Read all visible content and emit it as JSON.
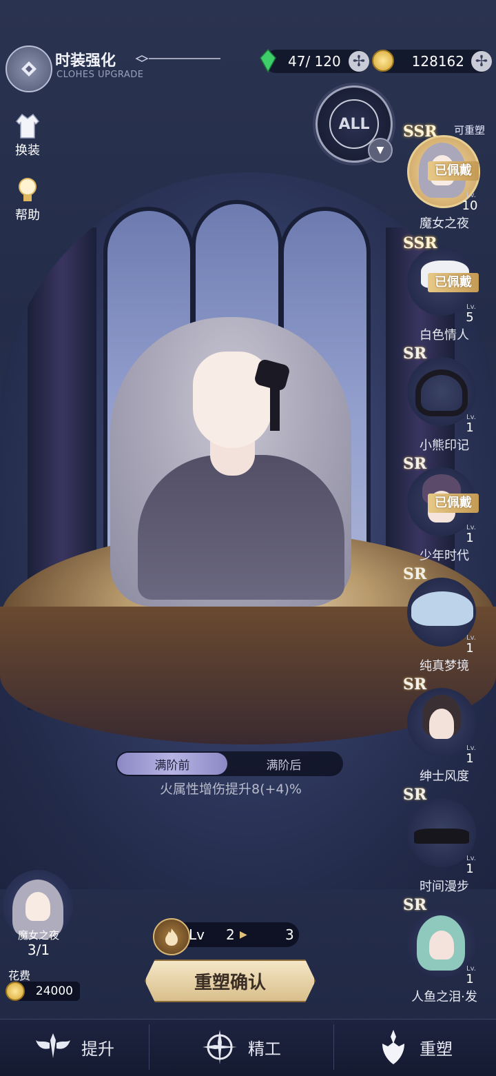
{
  "header": {
    "title": "时装强化",
    "subtitle": "CLOHES UPGRADE"
  },
  "resources": {
    "stamina": "47/ 120",
    "coins": "128162"
  },
  "side_menu": {
    "dress_up": "换装",
    "help": "帮助"
  },
  "filter": {
    "label": "ALL"
  },
  "items": [
    {
      "rarity": "SSR",
      "name": "魔女之夜",
      "lv_label": "Lv.",
      "level": "10",
      "worn": "已佩戴",
      "reshape_tag": "可重塑",
      "selected": true
    },
    {
      "rarity": "SSR",
      "name": "白色情人",
      "lv_label": "Lv.",
      "level": "5",
      "worn": "已佩戴"
    },
    {
      "rarity": "SR",
      "name": "小熊印记",
      "lv_label": "Lv.",
      "level": "1"
    },
    {
      "rarity": "SR",
      "name": "少年时代",
      "lv_label": "Lv.",
      "level": "1",
      "worn": "已佩戴"
    },
    {
      "rarity": "SR",
      "name": "纯真梦境",
      "lv_label": "Lv.",
      "level": "1"
    },
    {
      "rarity": "SR",
      "name": "绅士风度",
      "lv_label": "Lv.",
      "level": "1"
    },
    {
      "rarity": "SR",
      "name": "时间漫步",
      "lv_label": "Lv.",
      "level": "1"
    },
    {
      "rarity": "SR",
      "name": "人鱼之泪·发",
      "lv_label": "Lv.",
      "level": "1"
    }
  ],
  "tabs": {
    "before": "满阶前",
    "after": "满阶后"
  },
  "stat_text": "火属性增伤提升8(+4)%",
  "selected_item": {
    "name": "魔女之夜",
    "count": "3/1"
  },
  "cost": {
    "label": "花费",
    "value": "24000"
  },
  "level": {
    "label": "Lv",
    "from": "2",
    "to": "3"
  },
  "confirm_label": "重塑确认",
  "nav": {
    "upgrade": "提升",
    "refine": "精工",
    "reshape": "重塑"
  }
}
